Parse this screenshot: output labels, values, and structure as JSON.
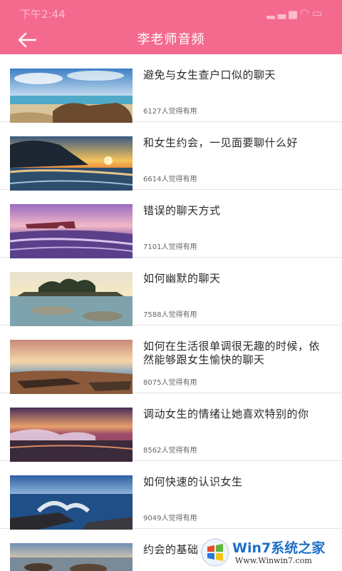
{
  "status_bar": {
    "time": "下午2:44",
    "icons": [
      "wechat-icon",
      "signal-icon",
      "wifi-icon",
      "battery-icon"
    ]
  },
  "header": {
    "title": "李老师音频",
    "back_icon": "arrow-left-icon",
    "background_color": "#f46a8e"
  },
  "items": [
    {
      "title": "避免与女生查户口似的聊天",
      "count": "6127人觉得有用",
      "thumb": "beach-rocks"
    },
    {
      "title": "和女生约会，一见面要聊什么好",
      "count": "6614人觉得有用",
      "thumb": "sunset-cliff"
    },
    {
      "title": "错误的聊天方式",
      "count": "7101人觉得有用",
      "thumb": "rock-arch-purple"
    },
    {
      "title": "如何幽默的聊天",
      "count": "7588人觉得有用",
      "thumb": "island-trees"
    },
    {
      "title": "如何在生活很单调很无趣的时候，依然能够跟女生愉快的聊天",
      "count": "8075人觉得有用",
      "thumb": "rocky-shore-dusk"
    },
    {
      "title": "调动女生的情绪让她喜欢特别的你",
      "count": "8562人觉得有用",
      "thumb": "purple-wave-sunset"
    },
    {
      "title": "如何快速的认识女生",
      "count": "9049人觉得有用",
      "thumb": "blue-waves"
    },
    {
      "title": "约会的基础课",
      "count": "",
      "thumb": "pebble-beach"
    }
  ],
  "watermark": {
    "brand": "Win7系统之家",
    "url": "Www.Winwin7.com"
  }
}
